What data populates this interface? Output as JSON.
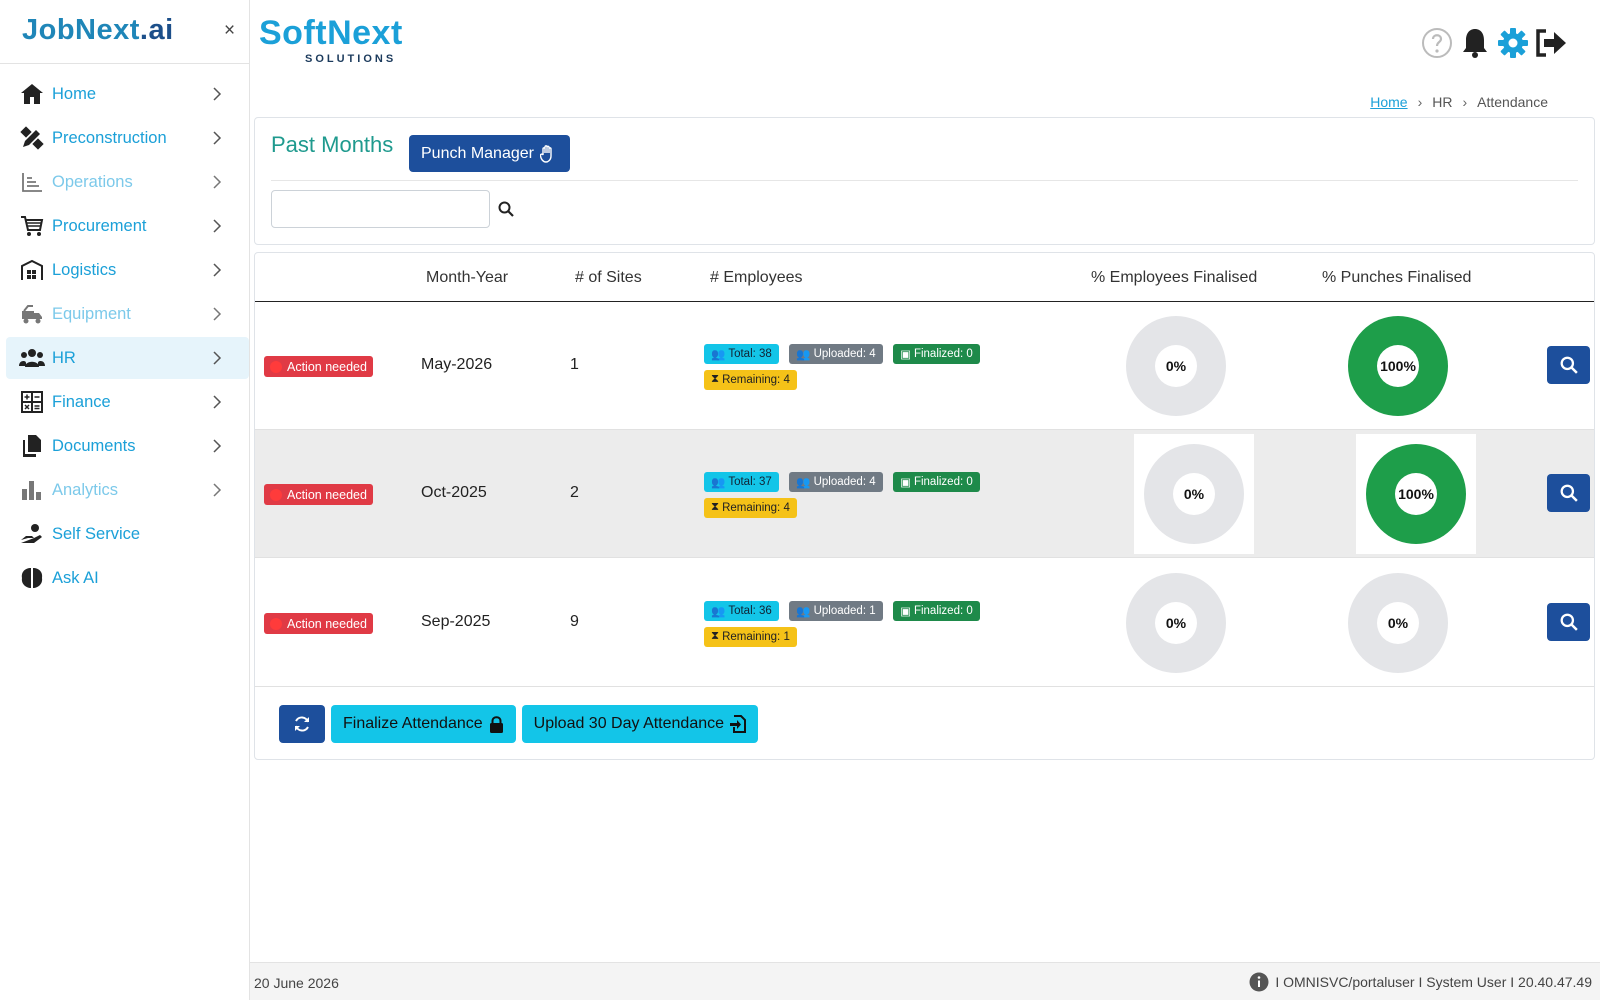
{
  "sidebar": {
    "logo_main": "JobNext",
    "logo_ai": ".ai",
    "close": "×",
    "items": [
      {
        "label": "Home"
      },
      {
        "label": "Preconstruction"
      },
      {
        "label": "Operations"
      },
      {
        "label": "Procurement"
      },
      {
        "label": "Logistics"
      },
      {
        "label": "Equipment"
      },
      {
        "label": "HR"
      },
      {
        "label": "Finance"
      },
      {
        "label": "Documents"
      },
      {
        "label": "Analytics"
      },
      {
        "label": "Self Service"
      },
      {
        "label": "Ask AI"
      }
    ]
  },
  "brand": {
    "main": "SoftNext",
    "sub": "SOLUTIONS"
  },
  "breadcrumb": {
    "home": "Home",
    "section": "HR",
    "page": "Attendance"
  },
  "card": {
    "title": "Past Months",
    "punch_manager_label": "Punch Manager",
    "search": {
      "placeholder": "",
      "value": ""
    }
  },
  "table": {
    "headers": {
      "month_year": "Month-Year",
      "sites": "# of Sites",
      "employees": "# Employees",
      "pct_employees": "% Employees Finalised",
      "pct_punches": "% Punches Finalised"
    },
    "rows": [
      {
        "status": "Action needed",
        "month": "May-2026",
        "sites": "1",
        "total": "Total: 38",
        "uploaded": "Uploaded: 4",
        "finalized": "Finalized: 0",
        "remaining": "Remaining: 4",
        "pct_employees": "0%",
        "pct_punches": "100%"
      },
      {
        "status": "Action needed",
        "month": "Oct-2025",
        "sites": "2",
        "total": "Total: 37",
        "uploaded": "Uploaded: 4",
        "finalized": "Finalized: 0",
        "remaining": "Remaining: 4",
        "pct_employees": "0%",
        "pct_punches": "100%"
      },
      {
        "status": "Action needed",
        "month": "Sep-2025",
        "sites": "9",
        "total": "Total: 36",
        "uploaded": "Uploaded: 1",
        "finalized": "Finalized: 0",
        "remaining": "Remaining: 1",
        "pct_employees": "0%",
        "pct_punches": "0%"
      }
    ]
  },
  "actions": {
    "finalize_label": "Finalize Attendance",
    "upload_label": "Upload 30 Day Attendance"
  },
  "status_bar": {
    "date": "20 June 2026",
    "info": "I OMNISVC/portaluser I System User I 20.40.47.49"
  },
  "colors": {
    "accent": "#1ba0d8",
    "primary_button": "#1d4f9c",
    "success": "#1e9e4a",
    "danger": "#e03a45",
    "warning": "#f5c218"
  }
}
